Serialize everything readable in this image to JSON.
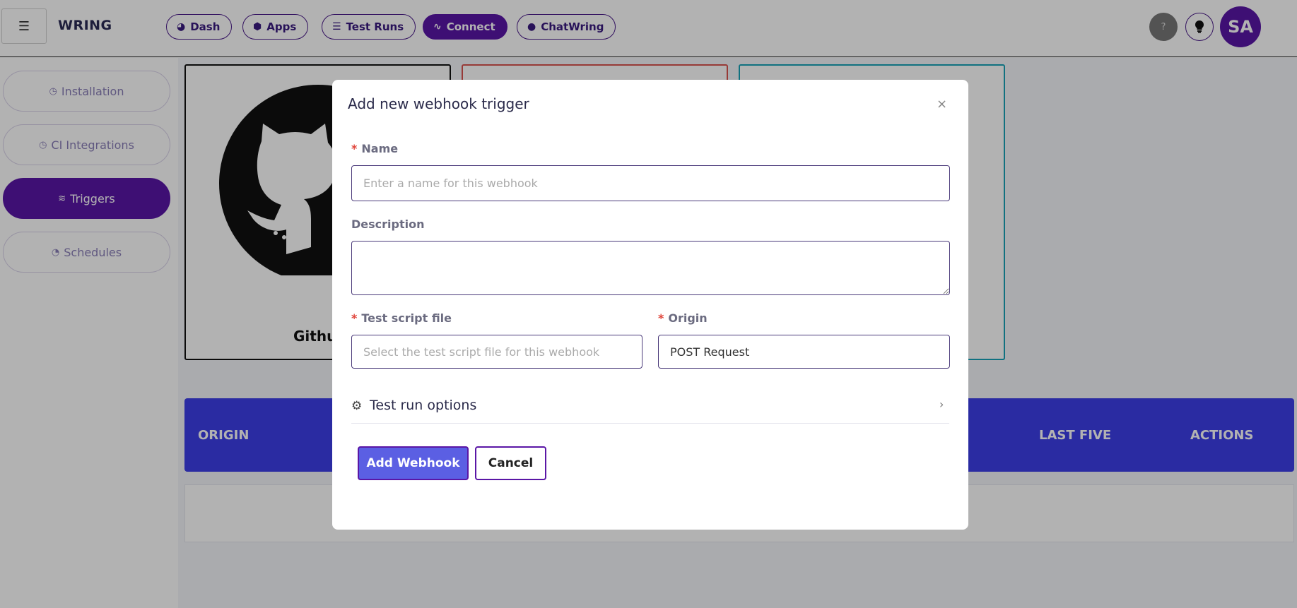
{
  "header": {
    "menu_icon": "hamburger-icon",
    "brand": "WRING",
    "nav": [
      {
        "label": "Dash",
        "icon": "pie-chart-icon"
      },
      {
        "label": "Apps",
        "icon": "cube-icon"
      },
      {
        "label": "Test Runs",
        "icon": "list-icon"
      },
      {
        "label": "Connect",
        "icon": "pulse-icon"
      },
      {
        "label": "ChatWring",
        "icon": "chat-bubble-icon"
      }
    ],
    "active_nav": "Connect",
    "help_icon": "?",
    "avatar_initials": "SA"
  },
  "sidebar": {
    "items": [
      {
        "label": "Installation",
        "icon": "clock-icon"
      },
      {
        "label": "CI Integrations",
        "icon": "clock-icon"
      },
      {
        "label": "Triggers",
        "icon": "stack-icon"
      },
      {
        "label": "Schedules",
        "icon": "gauge-icon"
      }
    ],
    "active": "Triggers"
  },
  "main": {
    "cards": [
      {
        "title": "Githu"
      }
    ],
    "table": {
      "headers": [
        "ORIGIN",
        "LAST FIVE",
        "ACTIONS"
      ]
    }
  },
  "modal": {
    "title": "Add new webhook trigger",
    "close": "×",
    "name": {
      "label": "Name",
      "required": "*",
      "placeholder": "Enter a name for this webhook",
      "value": ""
    },
    "description": {
      "label": "Description",
      "value": ""
    },
    "test_script": {
      "label": "Test script file",
      "required": "*",
      "placeholder": "Select the test script file for this webhook",
      "value": ""
    },
    "origin": {
      "label": "Origin",
      "required": "*",
      "value": "POST Request"
    },
    "options": {
      "label": "Test run options",
      "icon": "gear-icon",
      "chevron": "›"
    },
    "add_button": "Add Webhook",
    "cancel_button": "Cancel"
  },
  "colors": {
    "primary": "#5a16a6",
    "table_header": "#3d3ee8",
    "add_button": "#5b5fe3",
    "required": "#e0443a",
    "card_github": "#111111",
    "card_red": "#d9534f",
    "card_teal": "#17a2b8"
  }
}
